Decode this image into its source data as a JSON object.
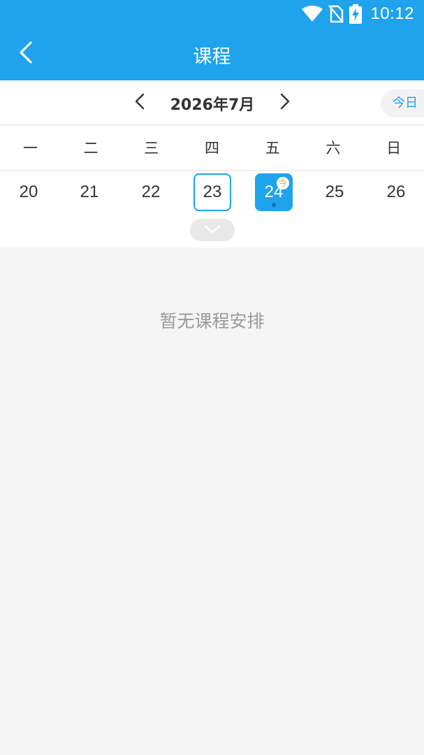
{
  "status_bar": {
    "time": "10:12",
    "icons": [
      "wifi-icon",
      "no-sim-icon",
      "battery-charging-icon"
    ]
  },
  "app_bar": {
    "title": "课程",
    "back_icon": "chevron-left-icon"
  },
  "calendar": {
    "month_label": "2026年7月",
    "today_button": "今日",
    "weekdays": [
      "一",
      "二",
      "三",
      "四",
      "五",
      "六",
      "日"
    ],
    "dates": [
      "20",
      "21",
      "22",
      "23",
      "24",
      "25",
      "26"
    ],
    "outlined_date": "23",
    "selected_date": "24",
    "today_badge": "今"
  },
  "content": {
    "empty_message": "暂无课程安排"
  },
  "colors": {
    "primary": "#1ea3ec",
    "badge_text": "#f0a020",
    "dot": "#1570c2"
  }
}
